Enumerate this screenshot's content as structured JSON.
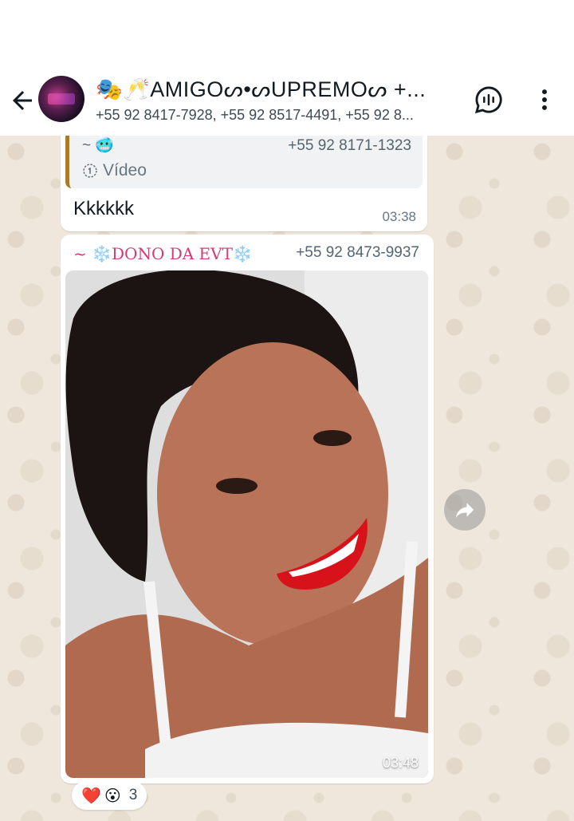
{
  "header": {
    "title": "🎭🥂AMIGOᔕ•ᔕUPREMOᔕ +...",
    "members": "+55 92 8417-7928, +55 92 8517-4491, +55 92 8..."
  },
  "icons": {
    "back": "arrow-left",
    "voice": "voice-chat",
    "menu": "more-vertical",
    "forward": "forward"
  },
  "messages": [
    {
      "quote": {
        "sender": "~ 🥶",
        "phone": "+55 92 8171-1323",
        "kind": "Vídeo"
      },
      "text": "Kkkkkk",
      "time": "03:38"
    },
    {
      "sender": "~ ❄️DONO DA EVT❄️",
      "phone": "+55 92 8473-9937",
      "time": "03:48",
      "reactions": {
        "emojis": [
          "❤️",
          "😮"
        ],
        "count": "3"
      }
    }
  ],
  "colors": {
    "quote_bar": "#a67c2b",
    "sender_name": "#d23b73",
    "chat_bg": "#efe7dc"
  }
}
